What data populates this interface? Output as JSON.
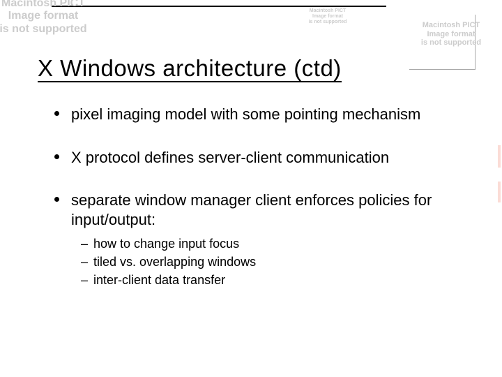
{
  "title": "X Windows architecture (ctd)",
  "bullets": [
    {
      "text": "pixel imaging model with some pointing mechanism",
      "sub": []
    },
    {
      "text": "X protocol defines server-client communication",
      "sub": []
    },
    {
      "text": "separate window manager client enforces policies for input/output:",
      "sub": [
        "how to change input focus",
        "tiled vs. overlapping windows",
        "inter-client data transfer"
      ]
    }
  ],
  "missing_image_lines": [
    "Macintosh PICT",
    "Image format",
    "is not supported"
  ]
}
